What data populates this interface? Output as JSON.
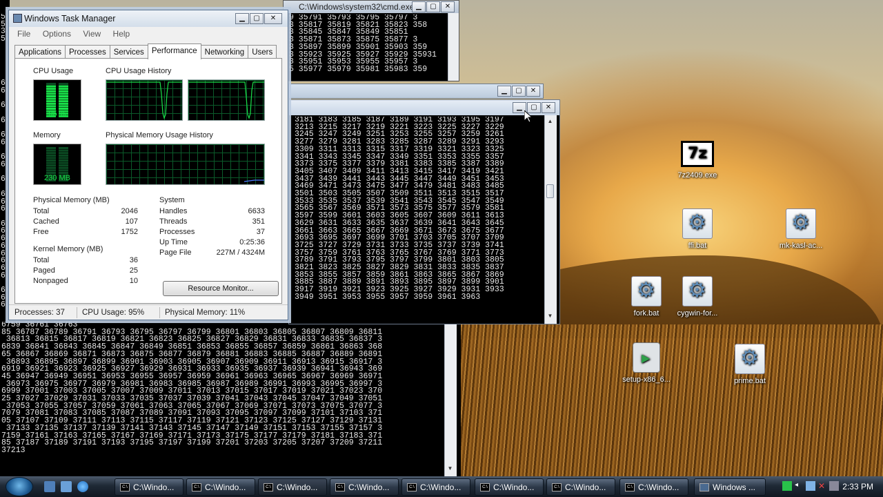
{
  "windows": {
    "cmd_title": "C:\\Windows\\system32\\cmd.exe"
  },
  "console_top": {
    "lines": [
      "9 35791 35793 35795 35797 3",
      "3 35817 35819 35821 35823 358",
      "3 35845 35847 35849 35851",
      "3 35871 35873 35875 35877 3",
      "3 35897 35899 35901 35903 359",
      "3 35923 35925 35927 35929 35931",
      "3 35951 35953 35955 35957 3",
      "5 35977 35979 35981 35983 359"
    ]
  },
  "console_main": {
    "lines": [
      "3181 3183 3185 3187 3189 3191 3193 3195 3197",
      "3213 3215 3217 3219 3221 3223 3225 3227 3229",
      "3245 3247 3249 3251 3253 3255 3257 3259 3261",
      "3277 3279 3281 3283 3285 3287 3289 3291 3293",
      "3309 3311 3313 3315 3317 3319 3321 3323 3325",
      "3341 3343 3345 3347 3349 3351 3353 3355 3357",
      "3373 3375 3377 3379 3381 3383 3385 3387 3389",
      "3405 3407 3409 3411 3413 3415 3417 3419 3421",
      "3437 3439 3441 3443 3445 3447 3449 3451 3453",
      "3469 3471 3473 3475 3477 3479 3481 3483 3485",
      "3501 3503 3505 3507 3509 3511 3513 3515 3517",
      "3533 3535 3537 3539 3541 3543 3545 3547 3549",
      "3565 3567 3569 3571 3573 3575 3577 3579 3581",
      "3597 3599 3601 3603 3605 3607 3609 3611 3613",
      "3629 3631 3633 3635 3637 3639 3641 3643 3645",
      "3661 3663 3665 3667 3669 3671 3673 3675 3677",
      "3693 3695 3697 3699 3701 3703 3705 3707 3709",
      "3725 3727 3729 3731 3733 3735 3737 3739 3741",
      "3757 3759 3761 3763 3765 3767 3769 3771 3773",
      "3789 3791 3793 3795 3797 3799 3801 3803 3805",
      "3821 3823 3825 3827 3829 3831 3833 3835 3837",
      "3853 3855 3857 3859 3861 3863 3865 3867 3869",
      "3885 3887 3889 3891 3893 3895 3897 3899 3901",
      "3917 3919 3921 3923 3925 3927 3929 3931 3933",
      "3949 3951 3953 3955 3957 3959 3961 3963"
    ]
  },
  "console_bottom": {
    "lines": [
      "6759 36761 36763",
      "85 36787 36789 36791 36793 36795 36797 36799 36801 36803 36805 36807 36809 36811",
      " 36813 36815 36817 36819 36821 36823 36825 36827 36829 36831 36833 36835 36837 3",
      "6839 36841 36843 36845 36847 36849 36851 36853 36855 36857 36859 36861 36863 368",
      "65 36867 36869 36871 36873 36875 36877 36879 36881 36883 36885 36887 36889 36891",
      " 36893 36895 36897 36899 36901 36903 36905 36907 36909 36911 36913 36915 36917 3",
      "6919 36921 36923 36925 36927 36929 36931 36933 36935 36937 36939 36941 36943 369",
      "45 36947 36949 36951 36953 36955 36957 36959 36961 36963 36965 36967 36969 36971",
      " 36973 36975 36977 36979 36981 36983 36985 36987 36989 36991 36993 36995 36997 3",
      "6999 37001 37003 37005 37007 37009 37011 37013 37015 37017 37019 37021 37023 370",
      "25 37027 37029 37031 37033 37035 37037 37039 37041 37043 37045 37047 37049 37051",
      " 37053 37055 37057 37059 37061 37063 37065 37067 37069 37071 37073 37075 37077 3",
      "7079 37081 37083 37085 37087 37089 37091 37093 37095 37097 37099 37101 37103 371",
      "05 37107 37109 37111 37113 37115 37117 37119 37121 37123 37125 37127 37129 37131",
      " 37133 37135 37137 37139 37141 37143 37145 37147 37149 37151 37153 37155 37157 3",
      "7159 37161 37163 37165 37167 37169 37171 37173 37175 37177 37179 37181 37183 371",
      "85 37187 37189 37191 37193 37195 37197 37199 37201 37203 37205 37207 37209 37211",
      "37213"
    ]
  },
  "left_strip": {
    "lines": [
      "5",
      "5",
      "3",
      "5",
      "",
      "",
      "",
      "",
      "",
      "6",
      "6",
      "",
      "6",
      "",
      "6",
      "",
      "6",
      "6",
      "",
      "6",
      "6",
      "",
      "6",
      "",
      "6",
      "6",
      "6",
      "",
      "6",
      "6",
      "6",
      "6",
      "6",
      "6",
      "6",
      "6",
      "",
      "6",
      "6",
      "6"
    ]
  },
  "taskmgr": {
    "title": "Windows Task Manager",
    "menu": [
      "File",
      "Options",
      "View",
      "Help"
    ],
    "tabs": [
      "Applications",
      "Processes",
      "Services",
      "Performance",
      "Networking",
      "Users"
    ],
    "active_tab": "Performance",
    "cpu_usage_label": "CPU Usage",
    "cpu_usage_value": "95 %",
    "cpu_usage_pct": 95,
    "cpu_history_label": "CPU Usage History",
    "memory_label": "Memory",
    "memory_value": "230 MB",
    "phys_history_label": "Physical Memory Usage History",
    "physical_memory": {
      "heading": "Physical Memory (MB)",
      "rows": [
        {
          "label": "Total",
          "value": "2046"
        },
        {
          "label": "Cached",
          "value": "107"
        },
        {
          "label": "Free",
          "value": "1752"
        }
      ]
    },
    "kernel_memory": {
      "heading": "Kernel Memory (MB)",
      "rows": [
        {
          "label": "Total",
          "value": "36"
        },
        {
          "label": "Paged",
          "value": "25"
        },
        {
          "label": "Nonpaged",
          "value": "10"
        }
      ]
    },
    "system": {
      "heading": "System",
      "rows": [
        {
          "label": "Handles",
          "value": "6633"
        },
        {
          "label": "Threads",
          "value": "351"
        },
        {
          "label": "Processes",
          "value": "37"
        },
        {
          "label": "Up Time",
          "value": "0:25:36"
        },
        {
          "label": "Page File",
          "value": "227M / 4324M"
        }
      ]
    },
    "resource_monitor_button": "Resource Monitor...",
    "status": {
      "processes": "Processes: 37",
      "cpu": "CPU Usage: 95%",
      "memory": "Physical Memory: 11%"
    }
  },
  "desktop_icons": [
    {
      "label": "7z2409.exe",
      "glyph": "7z",
      "kind": "archive-icon"
    },
    {
      "label": "ffi.bat",
      "kind": "batch-file-icon"
    },
    {
      "label": "mk-kasl-ac...",
      "kind": "batch-file-icon"
    },
    {
      "label": "fork.bat",
      "kind": "batch-file-icon"
    },
    {
      "label": "cygwin-for...",
      "kind": "batch-file-icon"
    },
    {
      "label": "setup-x86_6...",
      "kind": "installer-icon"
    },
    {
      "label": "prime.bat",
      "kind": "batch-file-icon"
    }
  ],
  "taskbar": {
    "buttons": [
      "C:\\Windo...",
      "C:\\Windo...",
      "C:\\Windo...",
      "C:\\Windo...",
      "C:\\Windo...",
      "C:\\Windo...",
      "C:\\Windo...",
      "C:\\Windo...",
      "Windows ..."
    ],
    "clock": "2:33 PM"
  },
  "colors": {
    "graph_green": "#19e34a",
    "graph_grid": "#0b5a2a",
    "console_text": "#e8e8e8"
  }
}
